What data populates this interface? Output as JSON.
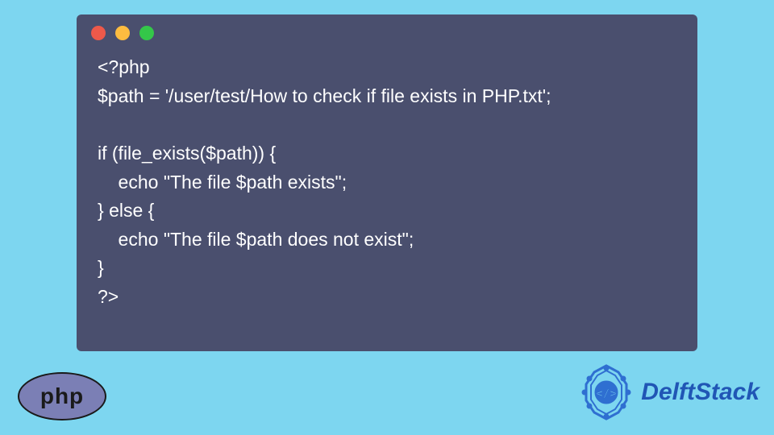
{
  "window": {
    "dots": [
      "red",
      "yellow",
      "green"
    ]
  },
  "code": {
    "lines": [
      "<?php",
      "$path = '/user/test/How to check if file exists in PHP.txt';",
      "",
      "if (file_exists($path)) {",
      "    echo \"The file $path exists\";",
      "} else {",
      "    echo \"The file $path does not exist\";",
      "}",
      "?>"
    ]
  },
  "language_badge": {
    "label": "php"
  },
  "brand": {
    "name": "DelftStack",
    "logo_color": "#2f6fd1"
  }
}
